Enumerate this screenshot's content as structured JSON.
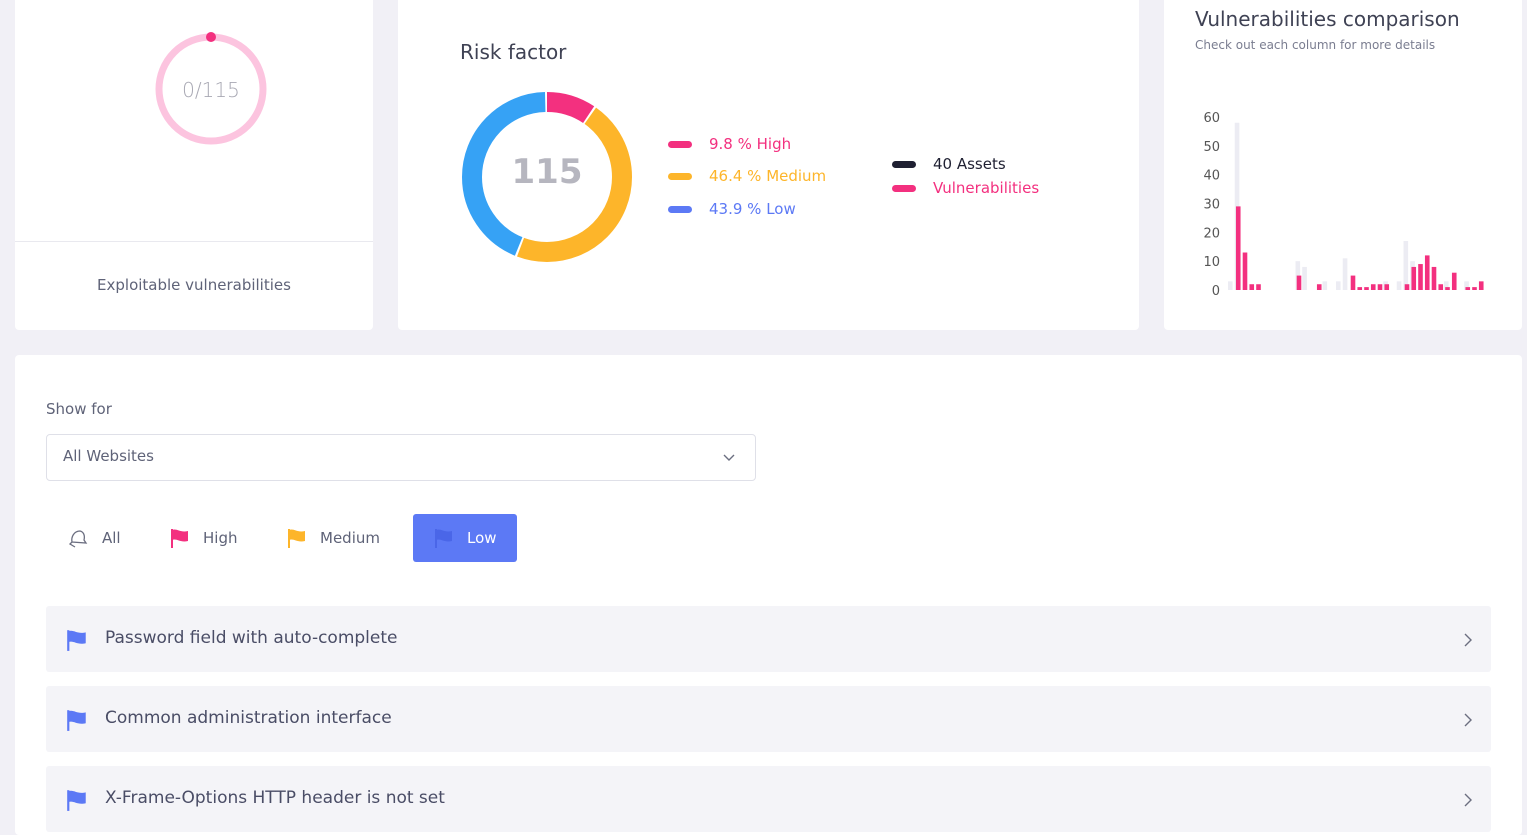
{
  "exploitable": {
    "ring_text": "0/115",
    "label": "Exploitable vulnerabilities",
    "ring_color": "#fcc4df",
    "dot_color": "#f3307f"
  },
  "risk": {
    "title": "Risk factor",
    "total": "115",
    "legend": [
      {
        "label": "9.8 % High",
        "color": "#f3307f"
      },
      {
        "label": "46.4 % Medium",
        "color": "#fdb52a"
      },
      {
        "label": "43.9 % Low",
        "color": "#5c79f5"
      }
    ],
    "secondary_legend": [
      {
        "label": "40 Assets",
        "color": "#1f2032"
      },
      {
        "label": "Vulnerabilities",
        "color": "#f3307f"
      }
    ],
    "segments": [
      {
        "name": "High",
        "percent": 9.8,
        "color": "#f3307f"
      },
      {
        "name": "Medium",
        "percent": 46.4,
        "color": "#fdb52a"
      },
      {
        "name": "Low",
        "percent": 43.9,
        "color": "#36a2f5"
      }
    ]
  },
  "chart_data": {
    "type": "bar",
    "title": "Vulnerabilities comparison",
    "subtitle": "Check out each column for more details",
    "ylim": [
      0,
      60
    ],
    "yticks": [
      60,
      50,
      40,
      30,
      20,
      10,
      0
    ],
    "grid": false,
    "series": [
      {
        "name": "Assets",
        "color": "#ececf3",
        "values": [
          3,
          58,
          0,
          0,
          0,
          0,
          0,
          0,
          0,
          0,
          10,
          8,
          0,
          0,
          3,
          0,
          3,
          11,
          0,
          0,
          0,
          0,
          0,
          3,
          0,
          3,
          17,
          10,
          0,
          0,
          0,
          0,
          3,
          0,
          0,
          3,
          0,
          0
        ]
      },
      {
        "name": "Vulnerabilities",
        "color": "#f3307f",
        "values": [
          0,
          29,
          13,
          2,
          2,
          0,
          0,
          0,
          0,
          0,
          5,
          0,
          0,
          2,
          0,
          0,
          0,
          0,
          5,
          1,
          1,
          2,
          2,
          2,
          0,
          0,
          2,
          8,
          9,
          12,
          8,
          2,
          1,
          6,
          0,
          1,
          1,
          3
        ]
      }
    ]
  },
  "filters": {
    "show_for_label": "Show for",
    "selected_site": "All Websites",
    "tabs": [
      {
        "label": "All",
        "icon": "bell-icon"
      },
      {
        "label": "High",
        "icon": "flag-icon",
        "color": "#f3307f"
      },
      {
        "label": "Medium",
        "icon": "flag-icon",
        "color": "#fdb52a"
      },
      {
        "label": "Low",
        "icon": "flag-icon",
        "color": "#5c79f5",
        "active": true
      }
    ]
  },
  "vulnerabilities": [
    {
      "title": "Password field with auto-complete"
    },
    {
      "title": "Common administration interface"
    },
    {
      "title": "X-Frame-Options HTTP header is not set"
    }
  ],
  "colors": {
    "accent": "#5c79f5",
    "high": "#f3307f",
    "medium": "#fdb52a"
  }
}
